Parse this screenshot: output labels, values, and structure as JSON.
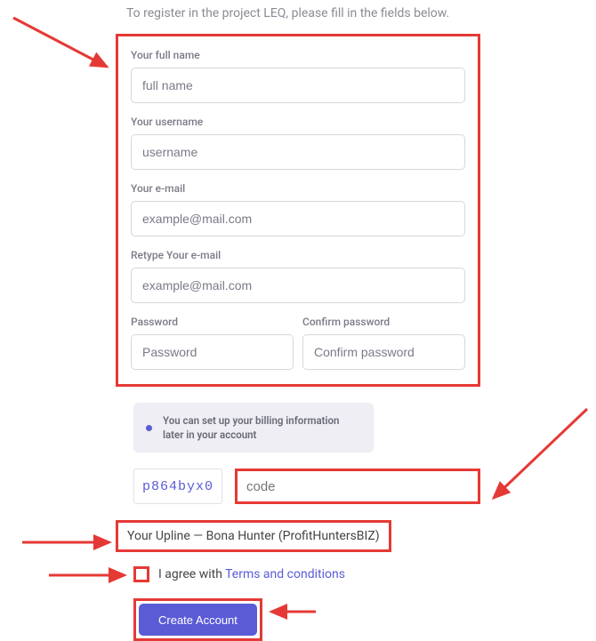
{
  "intro": "To register in the project LEQ, please fill in the fields below.",
  "form": {
    "fullname": {
      "label": "Your full name",
      "placeholder": "full name"
    },
    "username": {
      "label": "Your username",
      "placeholder": "username"
    },
    "email": {
      "label": "Your e-mail",
      "placeholder": "example@mail.com"
    },
    "email_confirm": {
      "label": "Retype Your e-mail",
      "placeholder": "example@mail.com"
    },
    "password": {
      "label": "Password",
      "placeholder": "Password"
    },
    "password_confirm": {
      "label": "Confirm password",
      "placeholder": "Confirm password"
    }
  },
  "info_text": "You can set up your billing information later in your account",
  "captcha": {
    "image_text": "p864byx0",
    "placeholder": "code"
  },
  "upline": "Your Upline — Bona Hunter (ProfitHuntersBIZ)",
  "agree": {
    "prefix": "I agree with ",
    "link": "Terms and conditions"
  },
  "submit_label": "Create Account",
  "colors": {
    "accent": "#5b5bd6",
    "highlight": "#e53935"
  }
}
